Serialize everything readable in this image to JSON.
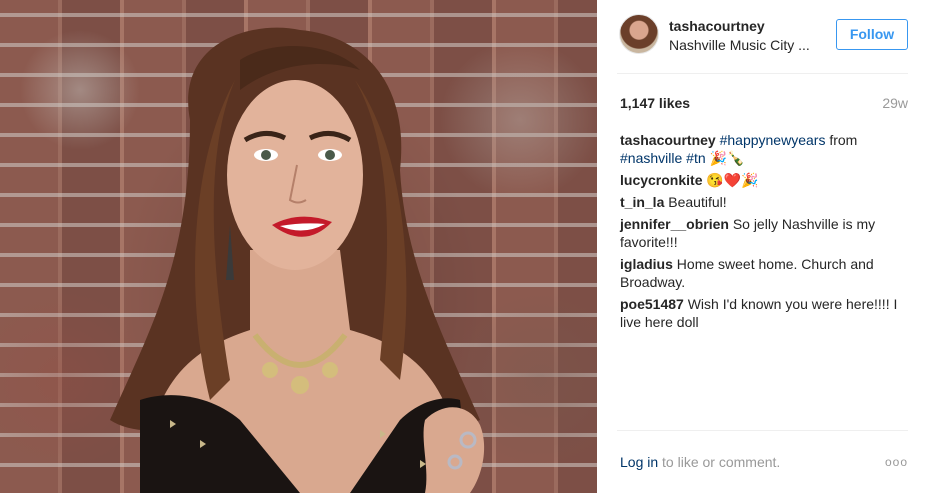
{
  "post": {
    "likes": "1,147 likes",
    "age": "29w"
  },
  "author": {
    "username": "tashacourtney",
    "location": "Nashville Music City ...",
    "follow_label": "Follow"
  },
  "comments": [
    {
      "user": "tashacourtney",
      "segments": [
        {
          "text": "#happynewyears",
          "type": "tag"
        },
        {
          "text": " from ",
          "type": "plain"
        },
        {
          "text": "#nashville",
          "type": "tag"
        },
        {
          "text": " ",
          "type": "plain"
        },
        {
          "text": "#tn",
          "type": "tag"
        },
        {
          "text": " 🎉🍾",
          "type": "plain"
        }
      ]
    },
    {
      "user": "lucycronkite",
      "segments": [
        {
          "text": "😘❤️🎉",
          "type": "plain"
        }
      ]
    },
    {
      "user": "t_in_la",
      "segments": [
        {
          "text": "Beautiful!",
          "type": "plain"
        }
      ]
    },
    {
      "user": "jennifer__obrien",
      "segments": [
        {
          "text": "So jelly Nashville is my favorite!!!",
          "type": "plain"
        }
      ]
    },
    {
      "user": "igladius",
      "segments": [
        {
          "text": "Home sweet home. Church and Broadway.",
          "type": "plain"
        }
      ]
    },
    {
      "user": "poe51487",
      "segments": [
        {
          "text": "Wish I'd known you were here!!!! I live here doll",
          "type": "plain"
        }
      ]
    }
  ],
  "footer": {
    "login_link": "Log in",
    "login_rest": " to like or comment.",
    "more_icon": "ooo"
  },
  "icons": {
    "more": "more-options-icon"
  },
  "colors": {
    "link_blue": "#003569",
    "follow_blue": "#3897f0",
    "muted": "#999999"
  }
}
